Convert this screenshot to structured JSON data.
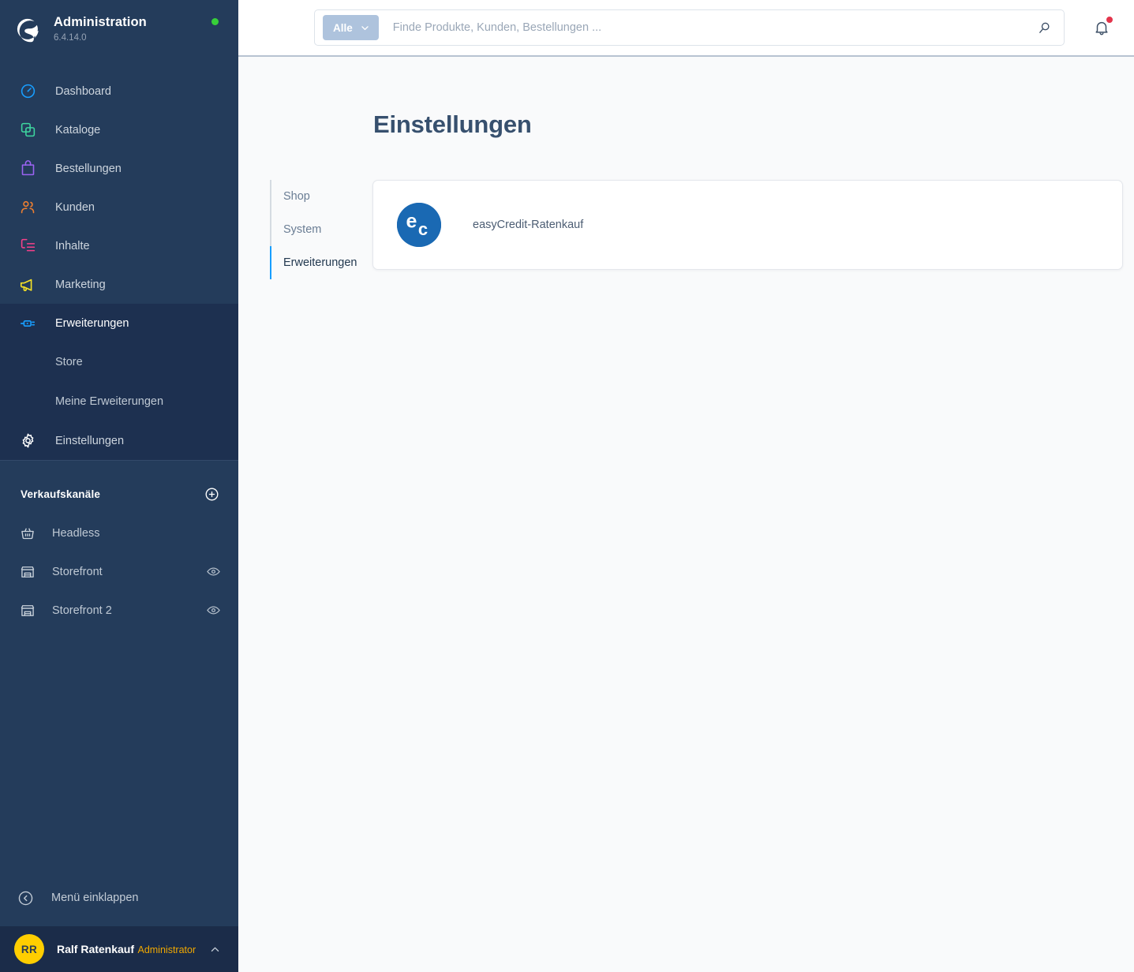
{
  "brand": {
    "logo_icon": "shopware-logo-icon",
    "title": "Administration",
    "version": "6.4.14.0",
    "status_dot_color": "#37d039"
  },
  "sidebar": {
    "main_items": [
      {
        "label": "Dashboard",
        "icon": "dashboard-icon",
        "color": "#189eff"
      },
      {
        "label": "Kataloge",
        "icon": "catalog-icon",
        "color": "#3ed59f"
      },
      {
        "label": "Bestellungen",
        "icon": "orders-bag-icon",
        "color": "#9b63f2"
      },
      {
        "label": "Kunden",
        "icon": "customers-icon",
        "color": "#ef7f2f"
      },
      {
        "label": "Inhalte",
        "icon": "content-icon",
        "color": "#f5408a"
      },
      {
        "label": "Marketing",
        "icon": "megaphone-icon",
        "color": "#f5e126"
      }
    ],
    "extensions_group": {
      "label": "Erweiterungen",
      "icon": "plug-icon",
      "color": "#189eff",
      "active": true,
      "children": [
        {
          "label": "Store"
        },
        {
          "label": "Meine Erweiterungen"
        }
      ]
    },
    "settings_item": {
      "label": "Einstellungen",
      "icon": "gear-icon",
      "color": "#ffffff"
    },
    "channels": {
      "title": "Verkaufskanäle",
      "add_icon": "plus-circle-icon",
      "items": [
        {
          "label": "Headless",
          "icon": "basket-icon",
          "has_preview": false,
          "preview_icon": ""
        },
        {
          "label": "Storefront",
          "icon": "storefront-icon",
          "has_preview": true,
          "preview_icon": "eye-icon"
        },
        {
          "label": "Storefront 2",
          "icon": "storefront-icon",
          "has_preview": true,
          "preview_icon": "eye-icon"
        }
      ]
    },
    "collapse": {
      "label": "Menü einklappen",
      "icon": "chevron-left-circle-icon"
    },
    "user": {
      "initials": "RR",
      "name": "Ralf Ratenkauf",
      "role": "Administrator",
      "caret_icon": "chevron-up-icon",
      "avatar_color": "#ffce00"
    }
  },
  "topbar": {
    "search": {
      "scope_label": "Alle",
      "scope_caret_icon": "chevron-down-icon",
      "value": "",
      "placeholder": "Finde Produkte, Kunden, Bestellungen ...",
      "submit_icon": "search-icon"
    },
    "notifications": {
      "icon": "bell-icon",
      "has_unread": true,
      "dot_color": "#e3344b"
    }
  },
  "main": {
    "page_title": "Einstellungen",
    "tabs": [
      {
        "label": "Shop",
        "active": false
      },
      {
        "label": "System",
        "active": false
      },
      {
        "label": "Erweiterungen",
        "active": true
      }
    ],
    "extension_cards": [
      {
        "name": "easyCredit-Ratenkauf",
        "logo_icon": "easycredit-logo-icon",
        "logo_color": "#1a69b3",
        "logo_letters": "ec"
      }
    ]
  }
}
